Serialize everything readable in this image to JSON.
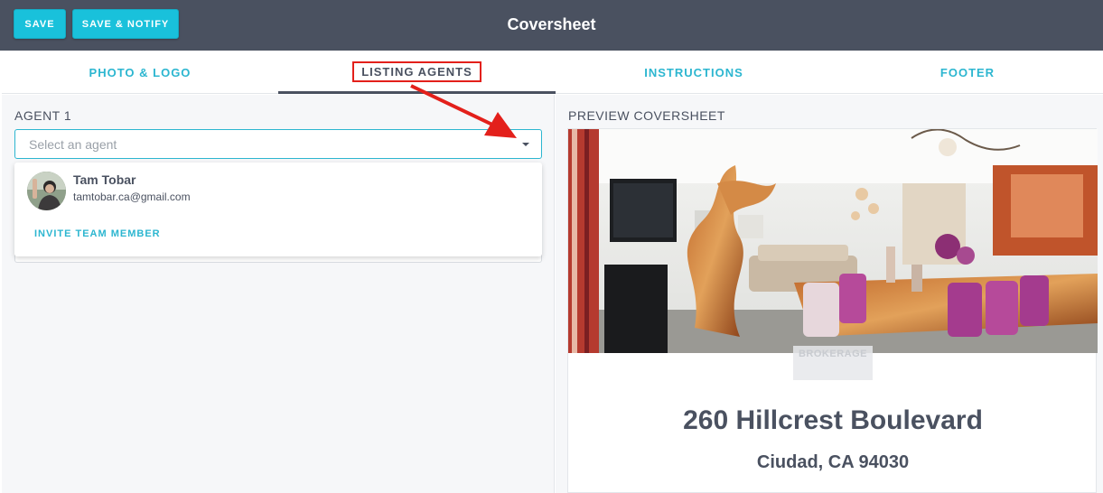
{
  "toolbar": {
    "save_label": "SAVE",
    "save_notify_label": "SAVE & NOTIFY",
    "title": "Coversheet"
  },
  "tabs": [
    {
      "label": "PHOTO & LOGO"
    },
    {
      "label": "LISTING AGENTS",
      "active": true
    },
    {
      "label": "INSTRUCTIONS"
    },
    {
      "label": "FOOTER"
    }
  ],
  "agent_section": {
    "label": "AGENT 1",
    "select_placeholder": "Select an agent",
    "options": [
      {
        "name": "Tam Tobar",
        "email": "tamtobar.ca@gmail.com"
      }
    ],
    "invite_label": "INVITE TEAM MEMBER"
  },
  "preview": {
    "label": "PREVIEW COVERSHEET",
    "brokerage_text": "BROKERAGE",
    "address": "260 Hillcrest Boulevard",
    "city_line": "Ciudad, CA 94030"
  },
  "colors": {
    "accent": "#19c1db",
    "header_bg": "#4a5160",
    "annotation_red": "#e3201b"
  }
}
